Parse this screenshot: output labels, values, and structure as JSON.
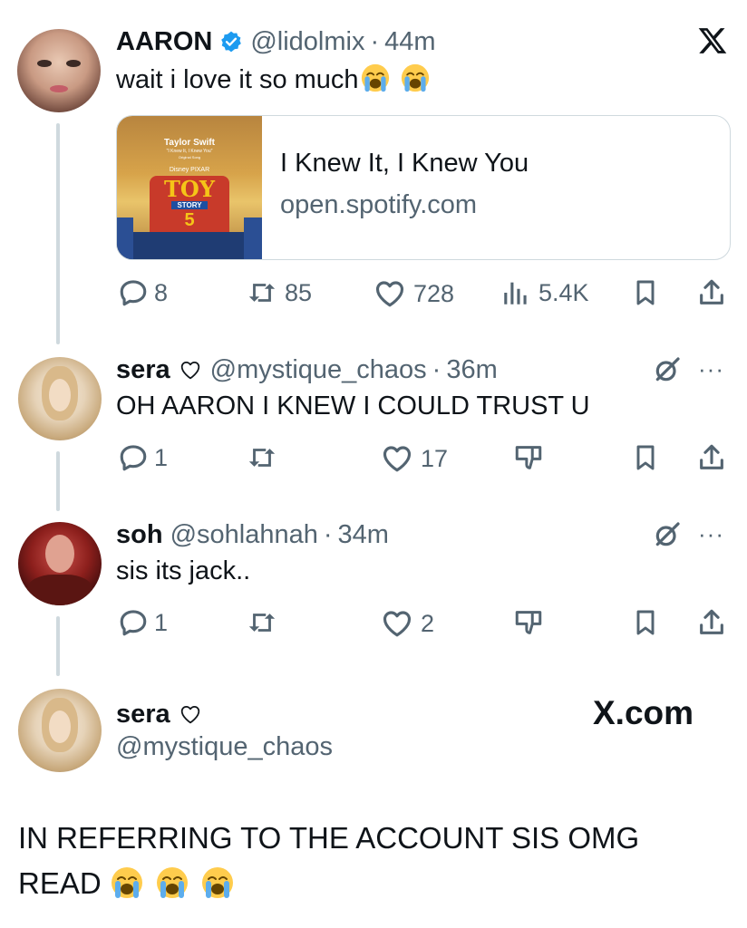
{
  "header": {
    "close_icon": "x-logo-icon"
  },
  "tweet1": {
    "name": "AARON",
    "verified_icon": "verified-badge-icon",
    "handle": "@lidolmix",
    "sep": "·",
    "time": "44m",
    "text": "wait i love it so much",
    "emojis": [
      "loudly-crying-face",
      "loudly-crying-face"
    ],
    "card": {
      "title": "I Knew It, I Knew You",
      "domain": "open.spotify.com",
      "thumb": {
        "artist": "Taylor Swift",
        "subtitle": "\"I Knew It, I Knew You\"",
        "small": "Original Song",
        "brand": "Disney PIXAR",
        "toy": "TOY",
        "story": "STORY",
        "number": "5"
      }
    },
    "actions": {
      "replies": "8",
      "retweets": "85",
      "likes": "728",
      "views": "5.4K"
    }
  },
  "tweet2": {
    "name": "sera",
    "handle": "@mystique_chaos",
    "sep": "·",
    "time": "36m",
    "text": "OH AARON I KNEW I COULD TRUST U",
    "actions": {
      "replies": "1",
      "retweets": "",
      "likes": "17"
    }
  },
  "tweet3": {
    "name": "soh",
    "handle": "@sohlahnah",
    "sep": "·",
    "time": "34m",
    "text": "sis its jack..",
    "actions": {
      "replies": "1",
      "retweets": "",
      "likes": "2"
    }
  },
  "profile": {
    "name": "sera",
    "handle": "@mystique_chaos",
    "watermark": "X.com"
  },
  "caption": {
    "line1": "IN REFERRING TO THE ACCOUNT SIS OMG",
    "line2": "READ",
    "emojis": [
      "loudly-crying-face",
      "loudly-crying-face",
      "loudly-crying-face"
    ]
  },
  "colors": {
    "text": "#0f1419",
    "muted": "#536471",
    "verified": "#1d9bf0",
    "line": "#cfd9de"
  }
}
